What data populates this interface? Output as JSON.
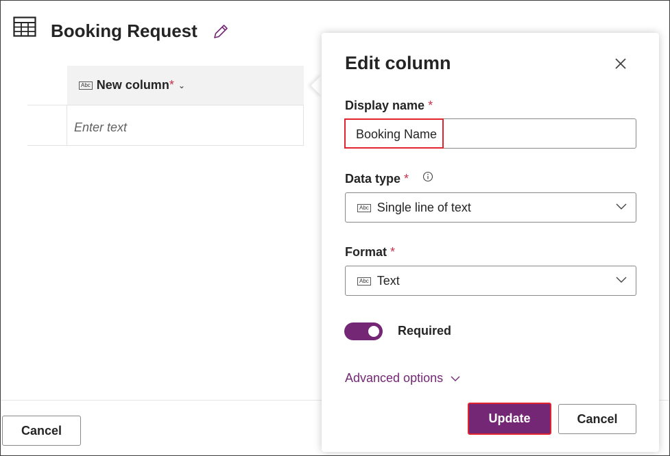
{
  "page": {
    "title": "Booking Request",
    "table_icon": "table-icon",
    "edit_icon": "pencil-icon"
  },
  "grid": {
    "column_header": "New column",
    "required_mark": "*",
    "column_type_icon": "Abc",
    "cell_placeholder": "Enter text"
  },
  "footer": {
    "cancel_label": "Cancel"
  },
  "panel": {
    "title": "Edit column",
    "close_icon": "close-icon",
    "display_name": {
      "label": "Display name",
      "required_mark": "*",
      "value": "Booking Name"
    },
    "data_type": {
      "label": "Data type",
      "required_mark": "*",
      "icon": "Abc",
      "value": "Single line of text"
    },
    "format": {
      "label": "Format",
      "required_mark": "*",
      "icon": "Abc",
      "value": "Text"
    },
    "required_toggle": {
      "label": "Required",
      "on": true
    },
    "advanced_options": "Advanced options",
    "update_label": "Update",
    "cancel_label": "Cancel"
  },
  "colors": {
    "accent": "#742774",
    "highlight": "#e0232e",
    "required": "#c4314b"
  }
}
